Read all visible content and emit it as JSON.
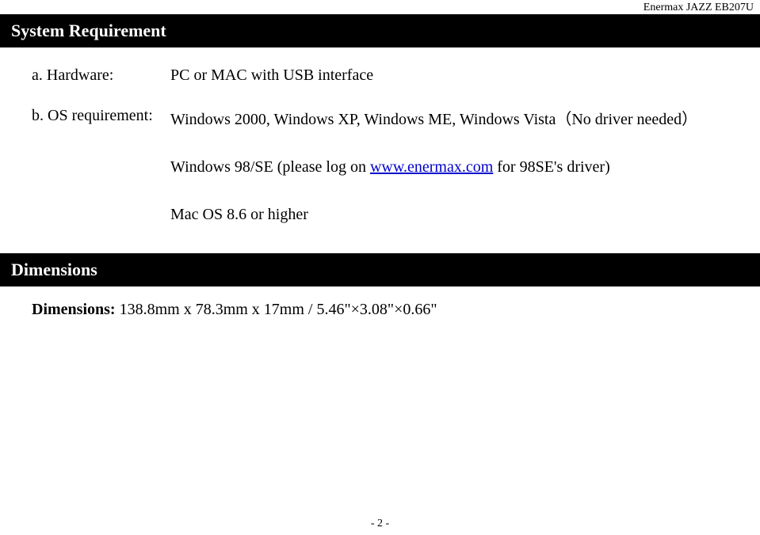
{
  "header": {
    "brand": "Enermax JAZZ EB207U"
  },
  "system_requirement": {
    "title": "System Requirement",
    "hardware": {
      "prefix": "a.",
      "label": "Hardware:",
      "value": "PC or MAC with USB interface"
    },
    "os": {
      "prefix": "b.",
      "label": "OS requirement:",
      "line1": "Windows 2000, Windows XP, Windows ME, Windows Vista（No driver needed）",
      "line2_prefix": "Windows 98/SE (please log on ",
      "line2_link": "www.enermax.com",
      "line2_suffix": " for 98SE's driver)",
      "line3": "Mac OS 8.6 or higher"
    }
  },
  "dimensions": {
    "title": "Dimensions",
    "label": "Dimensions:",
    "value": "138.8mm x 78.3mm x 17mm / 5.46\"×3.08\"×0.66\""
  },
  "footer": {
    "page_number": "- 2 -"
  }
}
